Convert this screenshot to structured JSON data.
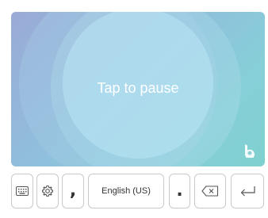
{
  "voice_panel": {
    "status_text": "Tap to pause"
  },
  "keyboard": {
    "keys": {
      "keyboard_icon": "keyboard-icon",
      "settings_icon": "gear-icon",
      "comma": ",",
      "space_label": "English (US)",
      "period": ".",
      "backspace_icon": "backspace-icon",
      "enter_icon": "enter-icon"
    }
  },
  "colors": {
    "panel_gradient_start": "#9aaad6",
    "panel_gradient_end": "#7fd0cf",
    "key_border": "#c9c9c9",
    "text_white": "#ffffff"
  }
}
